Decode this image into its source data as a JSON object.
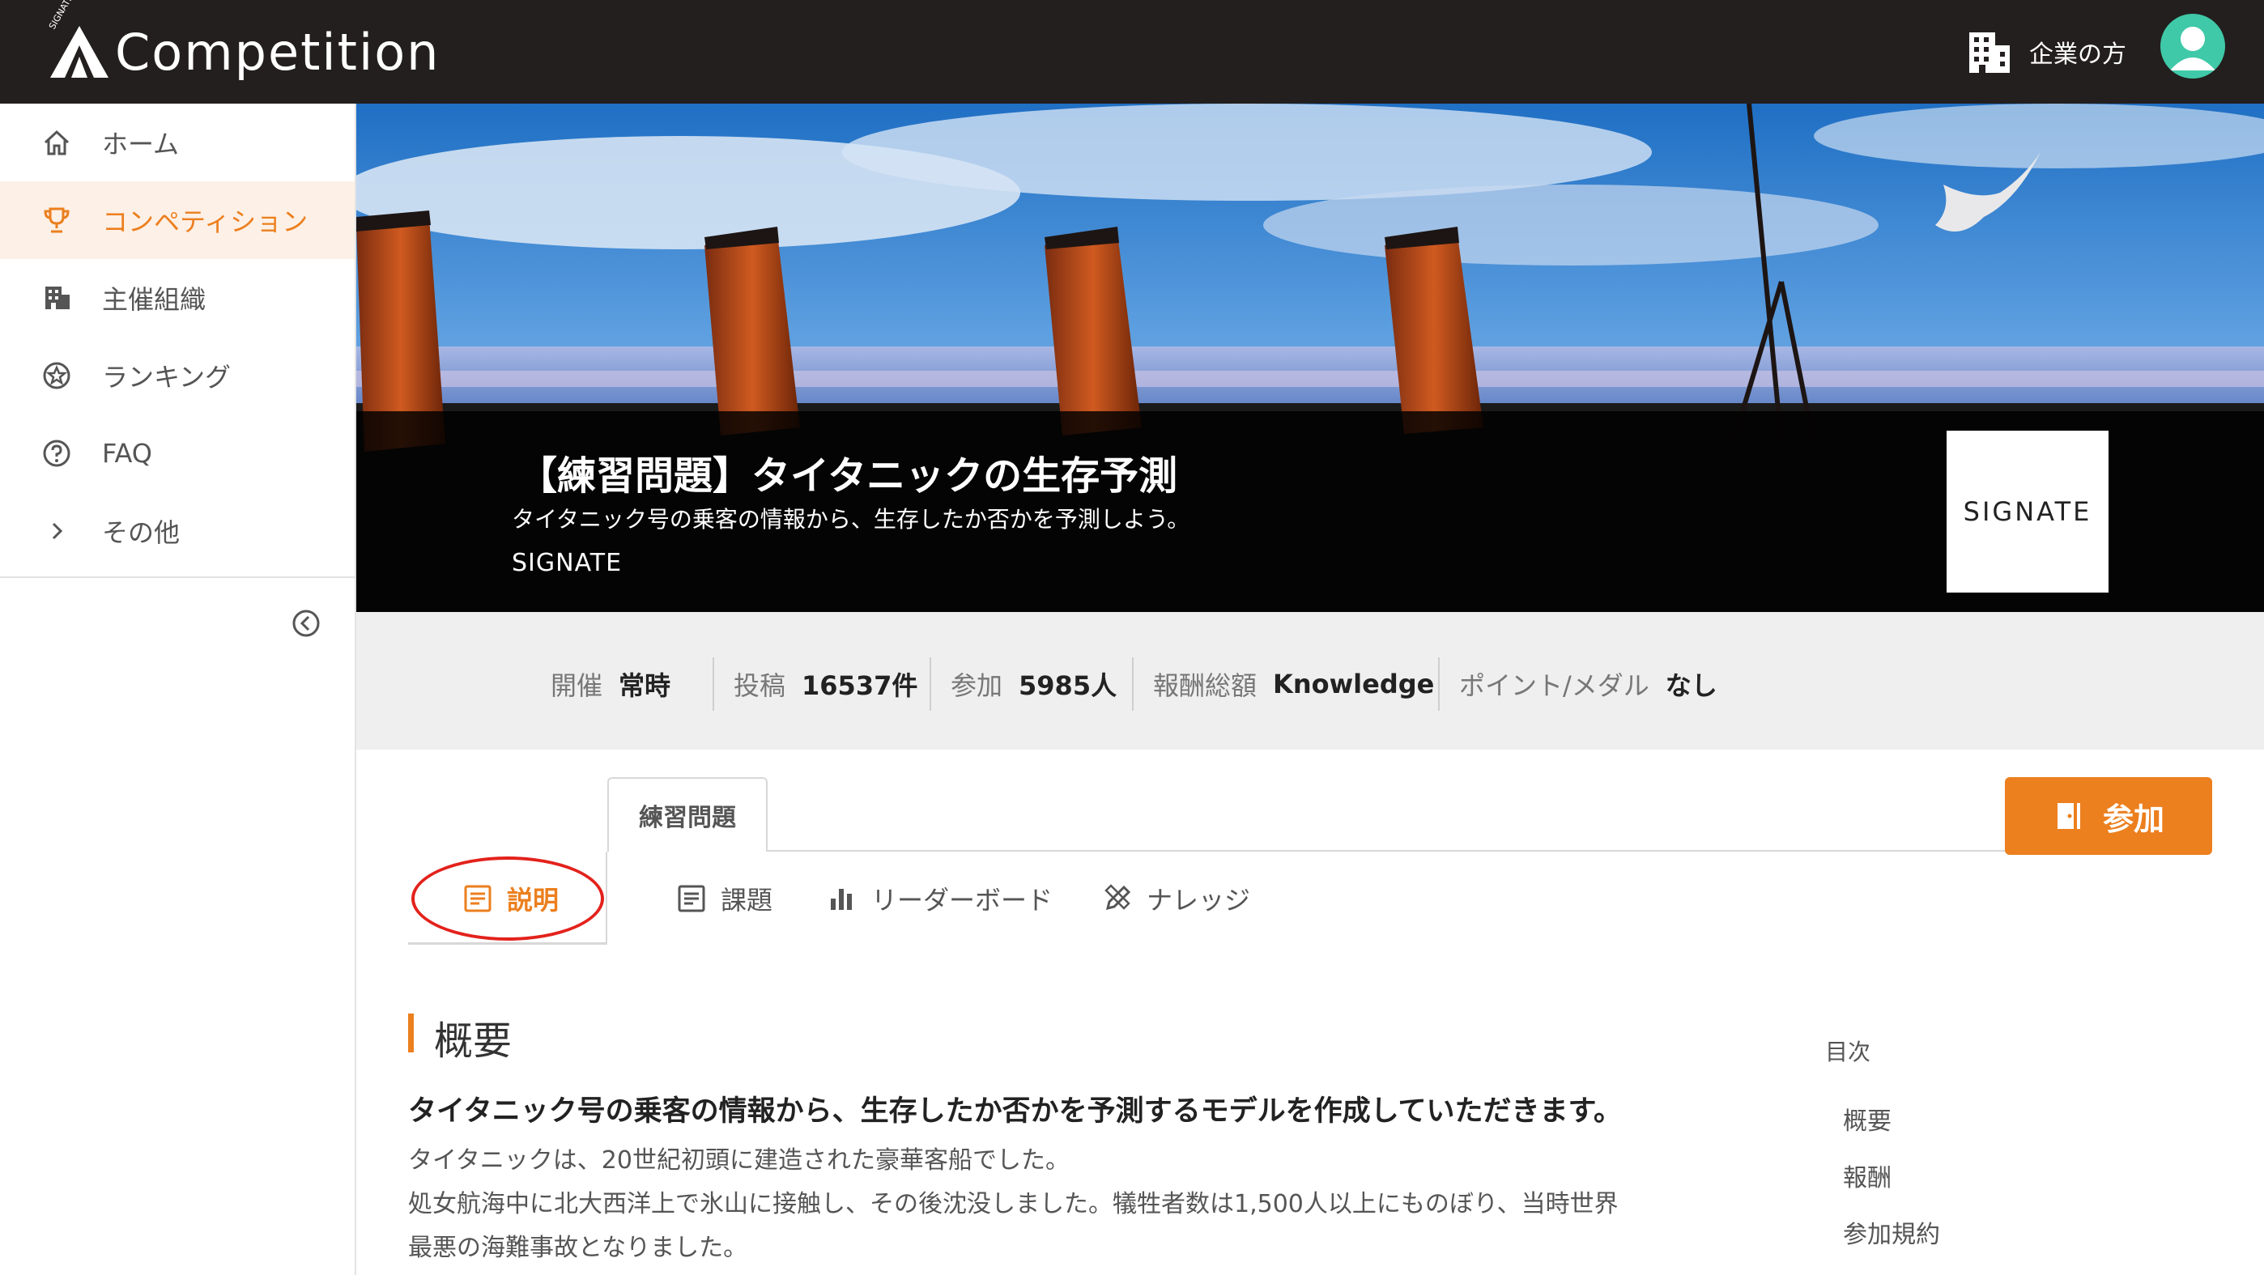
{
  "header": {
    "app_title": "Competition",
    "brand_small": "SIGNATE",
    "corporate_link": "企業の方"
  },
  "sidebar": {
    "items": [
      {
        "label": "ホーム",
        "icon": "home-icon"
      },
      {
        "label": "コンペティション",
        "icon": "trophy-icon",
        "active": true
      },
      {
        "label": "主催組織",
        "icon": "building-icon"
      },
      {
        "label": "ランキング",
        "icon": "star-badge-icon"
      },
      {
        "label": "FAQ",
        "icon": "help-circle-icon"
      },
      {
        "label": "その他",
        "icon": "chevron-right-icon"
      }
    ]
  },
  "hero": {
    "title": "【練習問題】タイタニックの生存予測",
    "subtitle": "タイタニック号の乗客の情報から、生存したか否かを予測しよう。",
    "organizer": "SIGNATE",
    "logo_text": "SIGNATE"
  },
  "info": {
    "period_label": "開催",
    "period_value": "常時",
    "posts_label": "投稿",
    "posts_value": "16537件",
    "participants_label": "参加",
    "participants_value": "5985人",
    "reward_label": "報酬総額",
    "reward_value": "Knowledge",
    "points_label": "ポイント/メダル",
    "points_value": "なし"
  },
  "tabs": {
    "category_badge": "練習問題",
    "join_label": "参加",
    "items": [
      {
        "label": "説明",
        "icon": "document-icon",
        "active": true
      },
      {
        "label": "課題",
        "icon": "document-icon"
      },
      {
        "label": "リーダーボード",
        "icon": "bar-chart-icon"
      },
      {
        "label": "ナレッジ",
        "icon": "pencil-ruler-icon"
      }
    ]
  },
  "content": {
    "section_title": "概要",
    "lead": "タイタニック号の乗客の情報から、生存したか否かを予測するモデルを作成していただきます。",
    "paragraphs": [
      "タイタニックは、20世紀初頭に建造された豪華客船でした。",
      "処女航海中に北大西洋上で氷山に接触し、その後沈没しました。犠牲者数は1,500人以上にものぼり、当時世界",
      "最悪の海難事故となりました。"
    ]
  },
  "toc": {
    "title": "目次",
    "items": [
      "概要",
      "報酬",
      "参加規約"
    ]
  },
  "colors": {
    "accent": "#ec7f1e",
    "topbar": "#231f1e",
    "highlight": "#e3221c",
    "avatar": "#3fc9a8"
  }
}
